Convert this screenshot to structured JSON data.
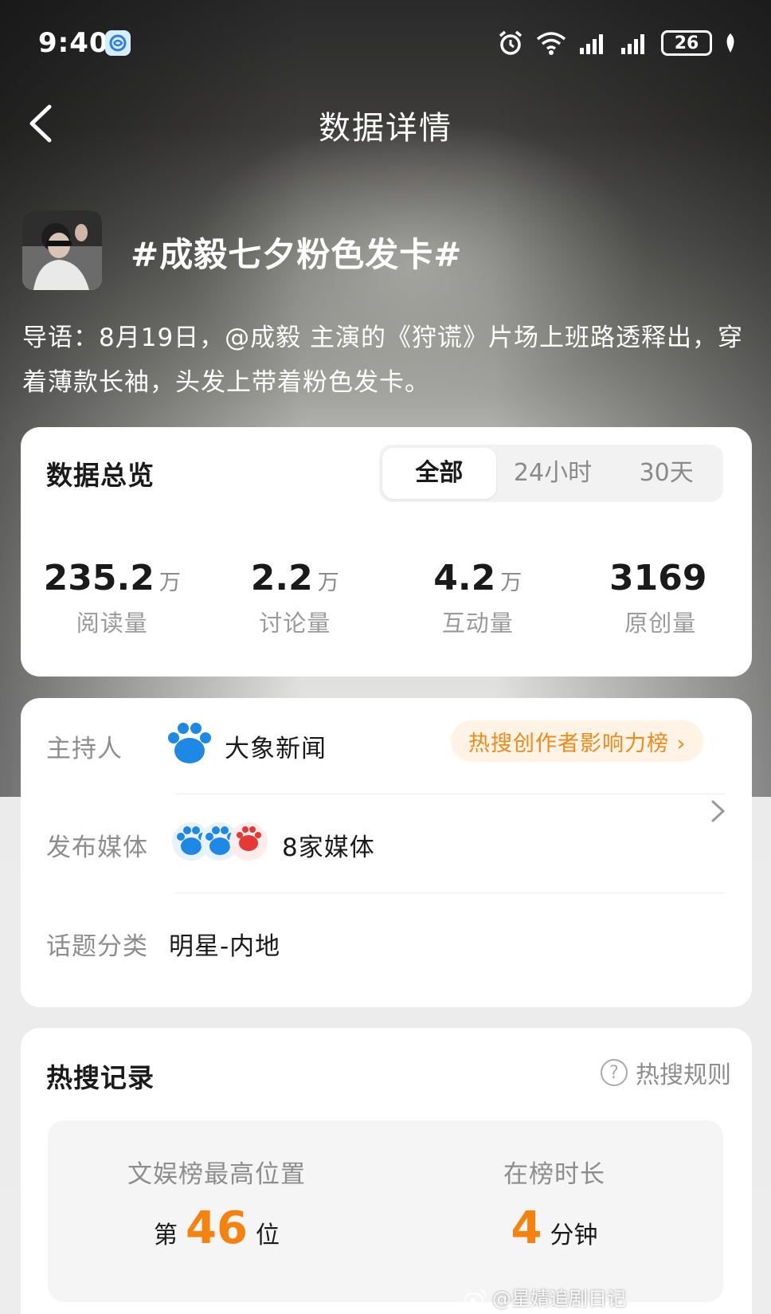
{
  "status_bar": {
    "time": "9:40",
    "battery": "26",
    "icons": [
      "alarm-icon",
      "wifi-icon",
      "signal-icon",
      "signal-icon",
      "battery-icon",
      "leaf-icon"
    ]
  },
  "nav": {
    "title": "数据详情",
    "back_icon": "chevron-left-icon"
  },
  "topic": {
    "title": "#成毅七夕粉色发卡#",
    "intro": "导语：8月19日，@成毅 主演的《狩谎》片场上班路透释出，穿着薄款长袖，头发上带着粉色发卡。"
  },
  "overview": {
    "heading": "数据总览",
    "tabs": [
      {
        "label": "全部",
        "active": true
      },
      {
        "label": "24小时",
        "active": false
      },
      {
        "label": "30天",
        "active": false
      }
    ],
    "stats": [
      {
        "value": "235.2",
        "unit": "万",
        "label": "阅读量"
      },
      {
        "value": "2.2",
        "unit": "万",
        "label": "讨论量"
      },
      {
        "value": "4.2",
        "unit": "万",
        "label": "互动量"
      },
      {
        "value": "3169",
        "unit": "",
        "label": "原创量"
      }
    ]
  },
  "info": {
    "host_label": "主持人",
    "host_name": "大象新闻",
    "host_badge": "热搜创作者影响力榜 ›",
    "media_label": "发布媒体",
    "media_text": "8家媒体",
    "category_label": "话题分类",
    "category_value": "明星-内地"
  },
  "record": {
    "heading": "热搜记录",
    "rules_label": "热搜规则",
    "best_label": "文娱榜最高位置",
    "best_prefix": "第",
    "best_value": "46",
    "best_suffix": "位",
    "duration_label": "在榜时长",
    "duration_value": "4",
    "duration_unit": "分钟"
  },
  "watermark": "@星婧追剧日记",
  "colors": {
    "accent_orange": "#f5820f",
    "badge_text": "#f08a1a",
    "badge_bg": "#fff3e6",
    "paw_blue": "#1e88e5"
  }
}
